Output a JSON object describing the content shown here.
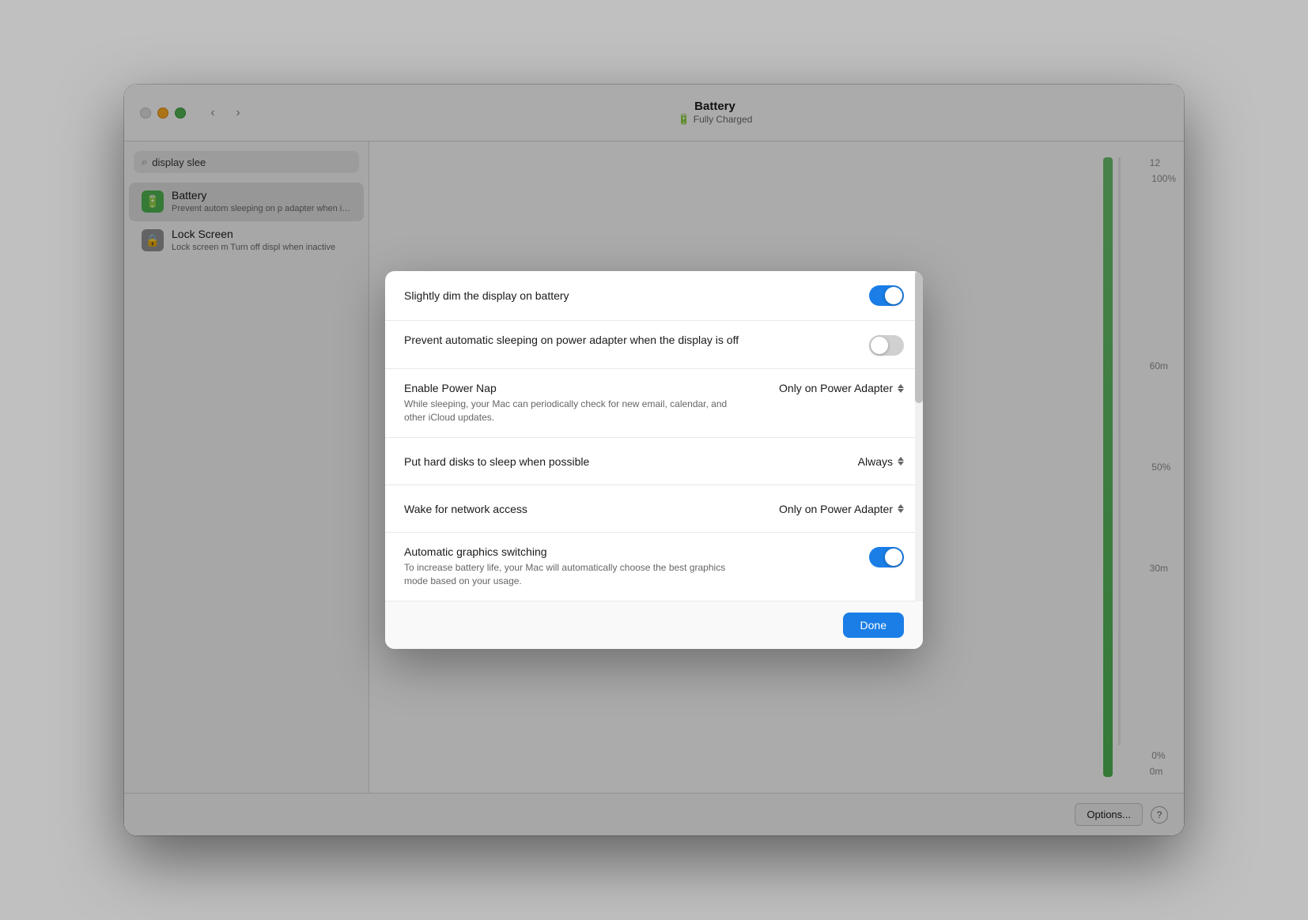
{
  "window": {
    "title": "Battery",
    "subtitle": "Fully Charged"
  },
  "nav": {
    "back_label": "‹",
    "forward_label": "›"
  },
  "search": {
    "value": "display slee",
    "placeholder": "Search"
  },
  "sidebar": {
    "items": [
      {
        "id": "battery",
        "title": "Battery",
        "desc": "Prevent autom sleeping on p adapter when is off",
        "icon": "🔋",
        "icon_type": "battery-green",
        "active": true
      },
      {
        "id": "lock-screen",
        "title": "Lock Screen",
        "desc": "Lock screen m Turn off displ when inactive",
        "icon": "🔒",
        "icon_type": "lock-gray",
        "active": false
      }
    ]
  },
  "chart": {
    "labels": [
      "100%",
      "50%",
      "0%",
      "12",
      "60m",
      "30m",
      "0m"
    ]
  },
  "bottom_bar": {
    "options_label": "Options...",
    "help_label": "?"
  },
  "modal": {
    "rows": [
      {
        "id": "dim-display",
        "label": "Slightly dim the display on battery",
        "description": "",
        "control_type": "toggle",
        "toggle_on": true,
        "picker_value": ""
      },
      {
        "id": "prevent-sleep",
        "label": "Prevent automatic sleeping on power adapter when the display is off",
        "description": "",
        "control_type": "toggle",
        "toggle_on": false,
        "picker_value": ""
      },
      {
        "id": "power-nap",
        "label": "Enable Power Nap",
        "description": "While sleeping, your Mac can periodically check for new email, calendar, and other iCloud updates.",
        "control_type": "picker",
        "toggle_on": false,
        "picker_value": "Only on Power Adapter"
      },
      {
        "id": "hard-disks",
        "label": "Put hard disks to sleep when possible",
        "description": "",
        "control_type": "picker",
        "toggle_on": false,
        "picker_value": "Always"
      },
      {
        "id": "wake-network",
        "label": "Wake for network access",
        "description": "",
        "control_type": "picker",
        "toggle_on": false,
        "picker_value": "Only on Power Adapter"
      },
      {
        "id": "graphics-switching",
        "label": "Automatic graphics switching",
        "description": "To increase battery life, your Mac will automatically choose the best graphics mode based on your usage.",
        "control_type": "toggle",
        "toggle_on": true,
        "picker_value": ""
      }
    ],
    "done_label": "Done"
  }
}
